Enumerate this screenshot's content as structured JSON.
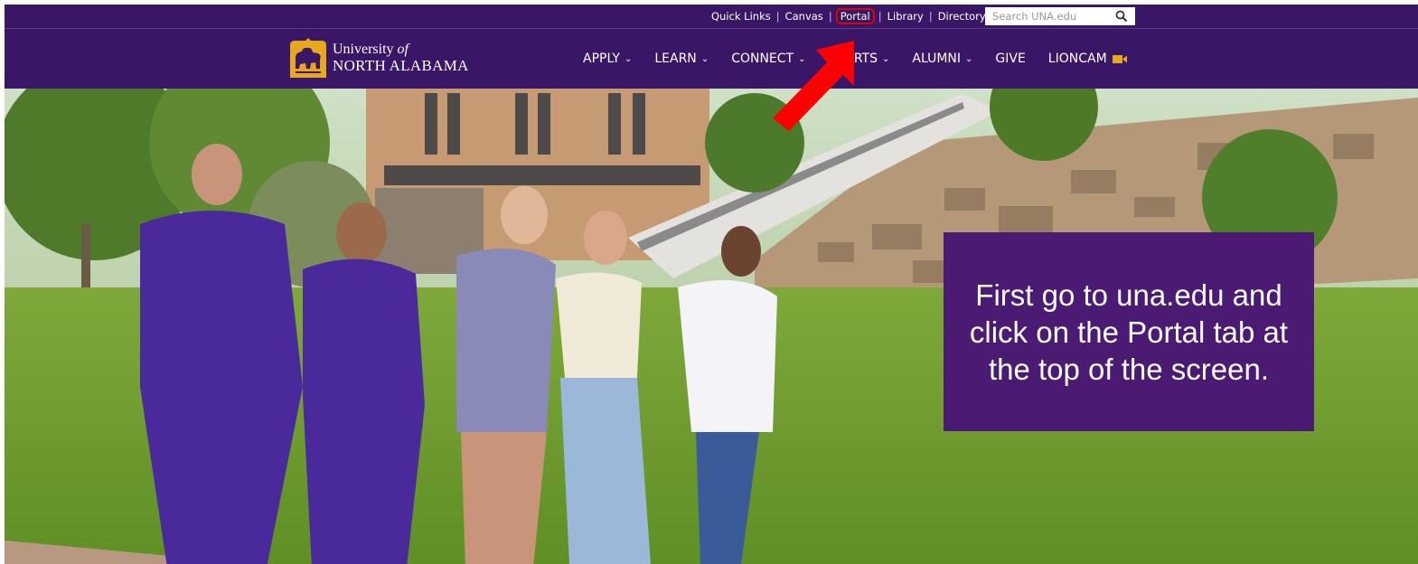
{
  "utility_bar": {
    "links": [
      "Quick Links",
      "Canvas",
      "Portal",
      "Library",
      "Directory"
    ],
    "separator": "|",
    "search": {
      "placeholder": "Search UNA.edu",
      "icon": "search-icon"
    }
  },
  "logo": {
    "line1_prefix": "University ",
    "line1_italic": "of",
    "line2": "NORTH ALABAMA",
    "icon": "lion-shield-icon",
    "accent": "#e8a81c"
  },
  "nav": {
    "items": [
      {
        "label": "APPLY",
        "dropdown": true
      },
      {
        "label": "LEARN",
        "dropdown": true
      },
      {
        "label": "CONNECT",
        "dropdown": true
      },
      {
        "label": "SPORTS",
        "dropdown": true
      },
      {
        "label": "ALUMNI",
        "dropdown": true
      },
      {
        "label": "GIVE",
        "dropdown": false
      },
      {
        "label": "LIONCAM",
        "dropdown": false,
        "icon": "video-camera-icon"
      }
    ],
    "chevron": "⌄"
  },
  "callout": {
    "text": "First go to una.edu and click on the Portal tab at the top of the screen."
  },
  "colors": {
    "purple": "#3a1766",
    "callout": "#4b1a72",
    "highlight": "#e00000",
    "gold": "#e8a81c"
  }
}
